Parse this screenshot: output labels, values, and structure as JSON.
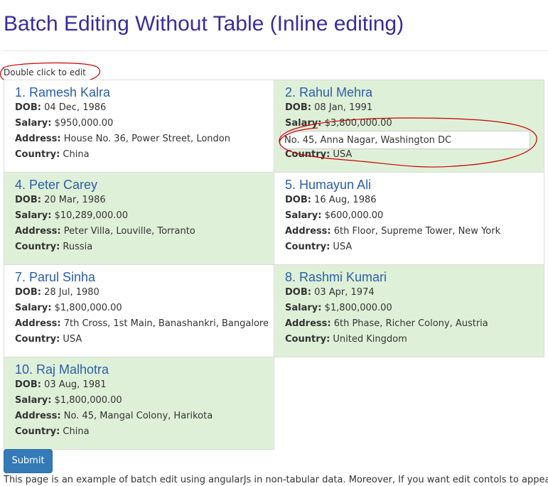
{
  "page": {
    "title": "Batch Editing Without Table (Inline editing)",
    "hint": "Double click to edit",
    "submit_label": "Submit",
    "footer_note": "This page is an example of batch edit using angularJs in non-tabular data. Moreover, If you want edit contols to appear only"
  },
  "labels": {
    "dob": "DOB:",
    "salary": "Salary:",
    "address": "Address:",
    "country": "Country:"
  },
  "colors": {
    "title": "#3a2d99",
    "name": "#2b5ea8",
    "shaded_card": "#dff0d8",
    "annotation": "#cc0000",
    "button": "#337ab7"
  },
  "editing": {
    "card_index": 1,
    "field": "address",
    "value": "No. 45, Anna Nagar, Washington DC"
  },
  "cards": [
    {
      "name": "1. Ramesh Kalra",
      "dob": "04 Dec, 1986",
      "salary": "$950,000.00",
      "address": "House No. 36, Power Street, London",
      "country": "China"
    },
    {
      "name": "2. Rahul Mehra",
      "dob": "08 Jan, 1991",
      "salary": "$3,800,000.00",
      "address": "No. 45, Anna Nagar, Washington DC",
      "country": "USA"
    },
    {
      "name": "4. Peter Carey",
      "dob": "20 Mar, 1986",
      "salary": "$10,289,000.00",
      "address": "Peter Villa, Louville, Torranto",
      "country": "Russia"
    },
    {
      "name": "5. Humayun Ali",
      "dob": "16 Aug, 1986",
      "salary": "$600,000.00",
      "address": "6th Floor, Supreme Tower, New York",
      "country": "USA"
    },
    {
      "name": "7. Parul Sinha",
      "dob": "28 Jul, 1980",
      "salary": "$1,800,000.00",
      "address": "7th Cross, 1st Main, Banashankri, Bangalore",
      "country": "USA"
    },
    {
      "name": "8. Rashmi Kumari",
      "dob": "03 Apr, 1974",
      "salary": "$1,800,000.00",
      "address": "6th Phase, Richer Colony, Austria",
      "country": "United Kingdom"
    },
    {
      "name": "10. Raj Malhotra",
      "dob": "03 Aug, 1981",
      "salary": "$1,800,000.00",
      "address": "No. 45, Mangal Colony, Harikota",
      "country": "China"
    }
  ]
}
